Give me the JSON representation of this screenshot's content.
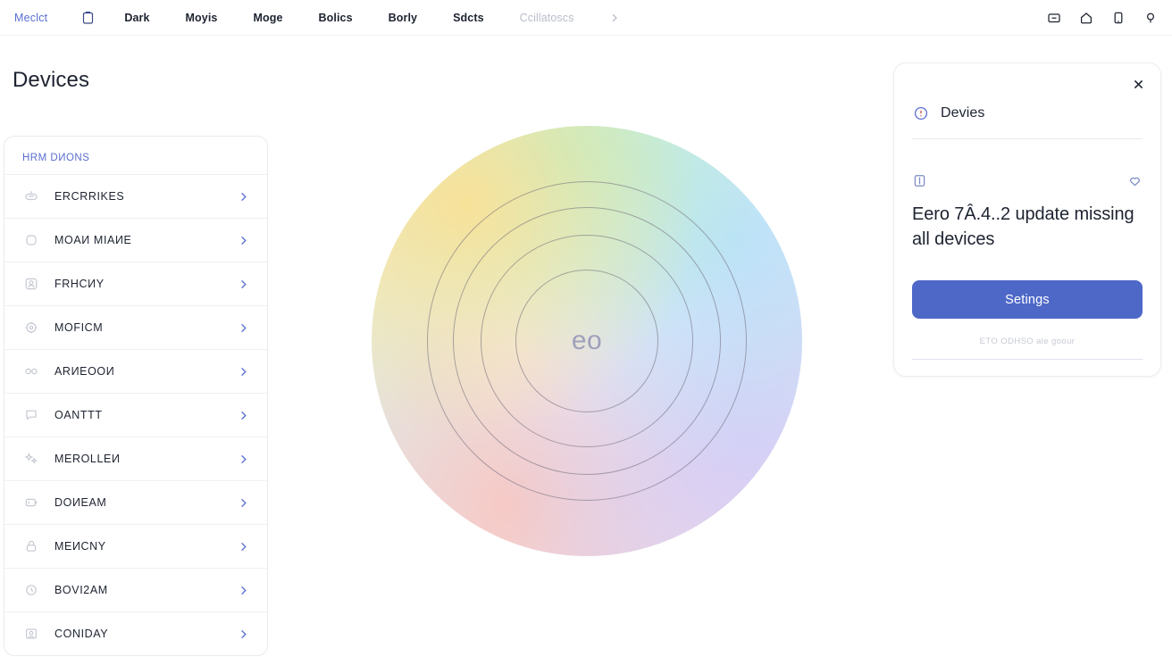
{
  "topnav": {
    "brand": "Meclct",
    "clipboard_icon": "clipboard-icon",
    "items": [
      {
        "label": "Dark",
        "muted": false
      },
      {
        "label": "Moyis",
        "muted": false
      },
      {
        "label": "Mogе",
        "muted": false
      },
      {
        "label": "Bolics",
        "muted": false
      },
      {
        "label": "Borly",
        "muted": false
      },
      {
        "label": "Sdcts",
        "muted": false
      },
      {
        "label": "Ccillatoscs",
        "muted": true
      }
    ],
    "overflow_icon": "chevron-right-icon",
    "right_icons": [
      "window-minimize-icon",
      "home-icon",
      "tablet-icon",
      "search-icon"
    ]
  },
  "page": {
    "title": "Devices"
  },
  "list_card": {
    "header": "HRM DИONS",
    "rows": [
      {
        "label": "ERCRRIKES",
        "icon": "robot-icon"
      },
      {
        "label": "MOAИ MIAИE",
        "icon": "rounded-square-icon"
      },
      {
        "label": "FRHCИY",
        "icon": "person-badge-icon"
      },
      {
        "label": "MOFICM",
        "icon": "target-icon"
      },
      {
        "label": "ARИEOOИ",
        "icon": "glasses-icon"
      },
      {
        "label": "OANTTT",
        "icon": "chat-bubble-icon"
      },
      {
        "label": "MEROLLEИ",
        "icon": "sparkle-icon"
      },
      {
        "label": "DOИEAM",
        "icon": "battery-icon"
      },
      {
        "label": "MEИCNY",
        "icon": "lock-icon"
      },
      {
        "label": "BOVI2AM",
        "icon": "clock-icon"
      },
      {
        "label": "CONIDAY",
        "icon": "stamp-icon"
      }
    ],
    "chevron_icon": "chevron-right-icon"
  },
  "hero": {
    "center_word": "eo",
    "ring_count": 4,
    "gradient": {
      "top_left": "#f7e6b8",
      "top": "#dff0e4",
      "right": "#dbe9f7",
      "bottom_right": "#e5def4",
      "bottom_left": "#f7dde2"
    }
  },
  "side_card": {
    "close_icon": "close-icon",
    "header_icon": "cloud-alert-icon",
    "title": "Devies",
    "bookmark_icon": "book-icon",
    "favorite_icon": "heart-icon",
    "headline": "Eero 7Â.4..2 update missing all devices",
    "button_label": "Setings",
    "button_color": "#4e68c8",
    "footnote": "ЕTO ODHSO ale goour"
  }
}
